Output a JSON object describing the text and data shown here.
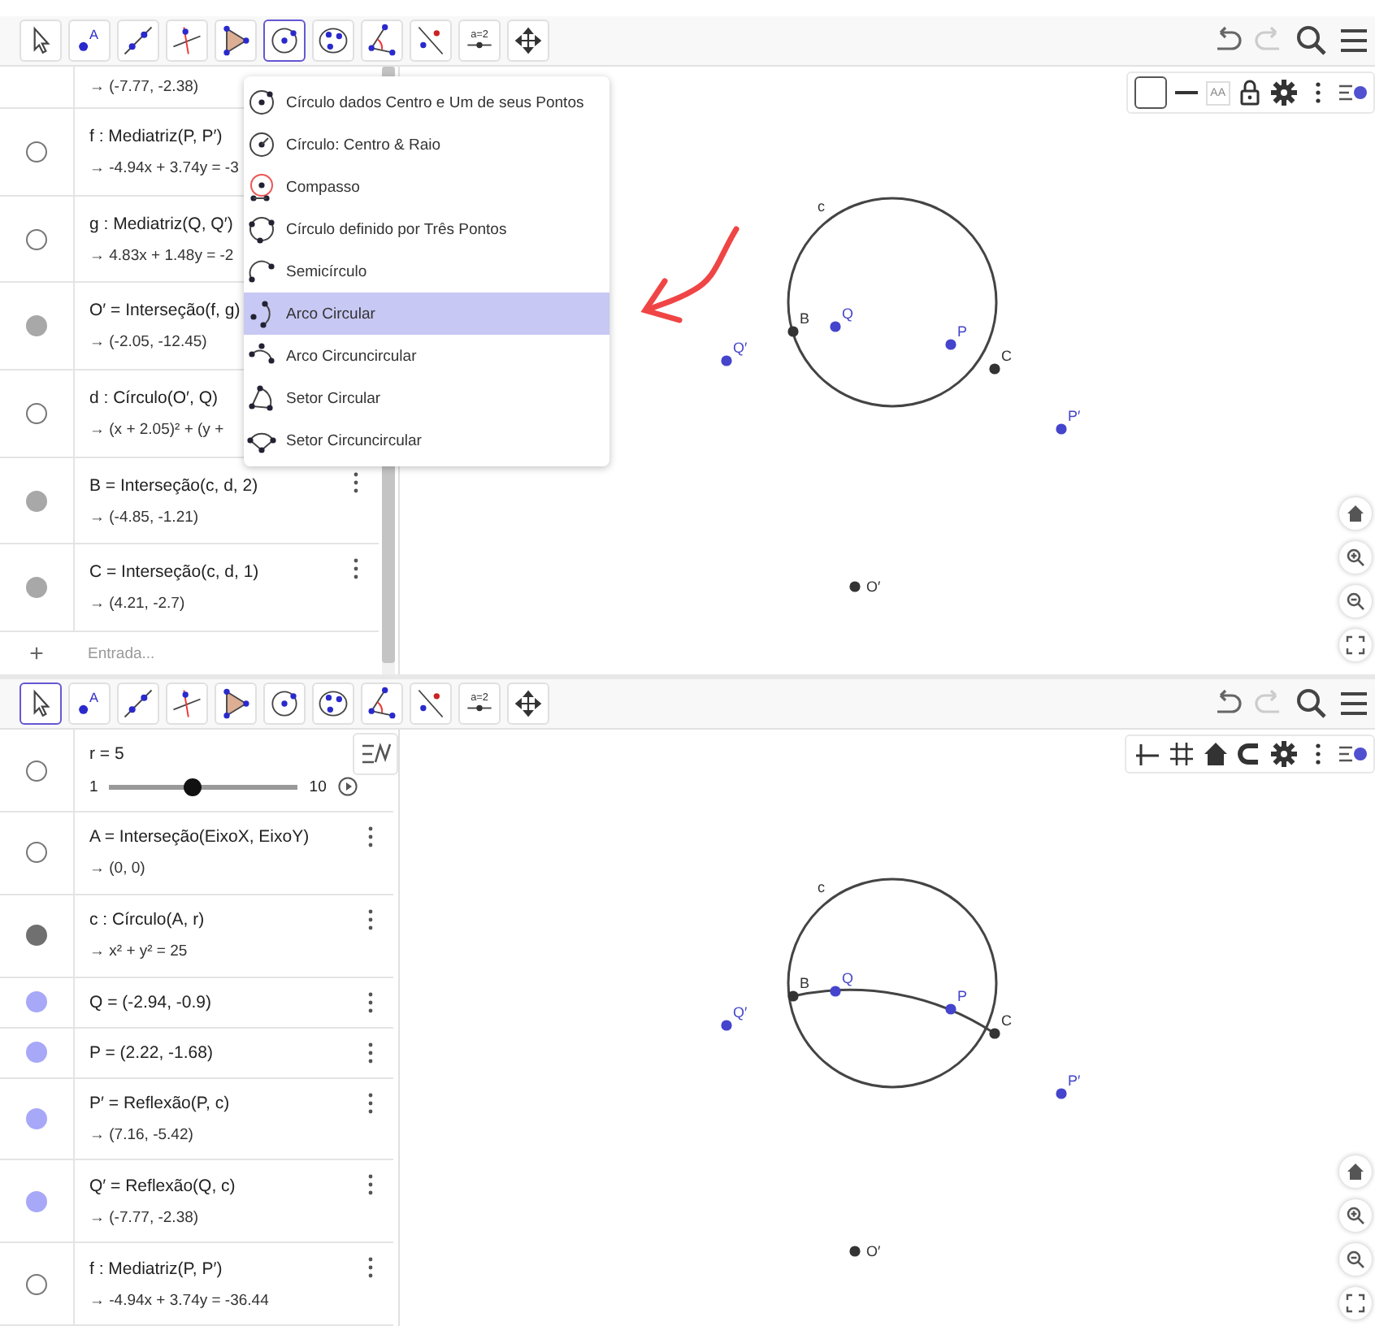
{
  "panes": [
    {
      "toolbar": {
        "tools": [
          {
            "kind": "move",
            "selected": false
          },
          {
            "kind": "point",
            "label": "A",
            "selected": false
          },
          {
            "kind": "line",
            "selected": false
          },
          {
            "kind": "perpendicular",
            "selected": false
          },
          {
            "kind": "polygon",
            "selected": false
          },
          {
            "kind": "circle",
            "selected": true
          },
          {
            "kind": "conic",
            "selected": false
          },
          {
            "kind": "angle",
            "selected": false
          },
          {
            "kind": "reflect",
            "selected": false
          },
          {
            "kind": "slider",
            "label": "a=2",
            "selected": false
          },
          {
            "kind": "pan",
            "selected": false
          }
        ],
        "undo_disabled": false,
        "redo_disabled": true
      },
      "dropdown": [
        {
          "kind": "circle-center-point",
          "label": "Círculo dados Centro e Um de seus Pontos",
          "selected": false
        },
        {
          "kind": "circle-center-radius",
          "label": "Círculo: Centro & Raio",
          "selected": false
        },
        {
          "kind": "compass",
          "label": "Compasso",
          "selected": false
        },
        {
          "kind": "circle-three-points",
          "label": "Círculo definido por Três Pontos",
          "selected": false
        },
        {
          "kind": "semicircle",
          "label": "Semicírculo",
          "selected": false
        },
        {
          "kind": "arc",
          "label": "Arco Circular",
          "selected": true
        },
        {
          "kind": "circumcircular-arc",
          "label": "Arco Circuncircular",
          "selected": false
        },
        {
          "kind": "sector",
          "label": "Setor Circular",
          "selected": false
        },
        {
          "kind": "circumcircular-sector",
          "label": "Setor Circuncircular",
          "selected": false
        }
      ],
      "algebra": {
        "rows": [
          {
            "kind": "partial",
            "value": "→ (-7.77, -2.38)"
          },
          {
            "kind": "two-line",
            "definition": "f : Mediatriz(P, P′)",
            "value": "→ -4.94x + 3.74y = -3",
            "visible": false,
            "menu_button": false
          },
          {
            "kind": "two-line",
            "definition": "g : Mediatriz(Q, Q′)",
            "value": "→ 4.83x + 1.48y = -2",
            "visible": false,
            "menu_button": false
          },
          {
            "kind": "two-line",
            "definition": "O′ = Interseção(f, g)",
            "value": "→ (-2.05, -12.45)",
            "visible": true,
            "color": "#a8a8a8",
            "menu_button": false
          },
          {
            "kind": "two-line",
            "definition": "d : Círculo(O′, Q)",
            "value": "→ (x + 2.05)² + (y +",
            "visible": false,
            "menu_button": false
          },
          {
            "kind": "two-line",
            "definition": "B = Interseção(c, d, 2)",
            "value": "→ (-4.85, -1.21)",
            "visible": true,
            "color": "#a8a8a8",
            "menu_button": true
          },
          {
            "kind": "two-line",
            "definition": "C = Interseção(c, d, 1)",
            "value": "→ (4.21, -2.7)",
            "visible": true,
            "color": "#a8a8a8",
            "menu_button": true
          }
        ],
        "input_add": "+",
        "input_placeholder": "Entrada...",
        "algebra_toggle": false
      },
      "style_bar": [
        {
          "kind": "color"
        },
        {
          "kind": "line-style"
        },
        {
          "kind": "text-size",
          "label": "AA"
        },
        {
          "kind": "lock"
        },
        {
          "kind": "settings"
        },
        {
          "kind": "more"
        },
        {
          "kind": "toggle"
        }
      ],
      "graphics": {
        "circle_label": "c",
        "arc": false,
        "points": [
          {
            "label": "B",
            "color": "#333333"
          },
          {
            "label": "Q",
            "color": "#4444cc"
          },
          {
            "label": "P",
            "color": "#4444cc"
          },
          {
            "label": "C",
            "color": "#333333"
          },
          {
            "label": "Q′",
            "color": "#4444cc"
          },
          {
            "label": "P′",
            "color": "#4444cc"
          },
          {
            "label": "O′",
            "color": "#333333"
          }
        ]
      }
    },
    {
      "toolbar": {
        "tools": [
          {
            "kind": "move",
            "selected": true
          },
          {
            "kind": "point",
            "label": "A",
            "selected": false
          },
          {
            "kind": "line",
            "selected": false
          },
          {
            "kind": "perpendicular",
            "selected": false
          },
          {
            "kind": "polygon",
            "selected": false
          },
          {
            "kind": "circle",
            "selected": false
          },
          {
            "kind": "conic",
            "selected": false
          },
          {
            "kind": "angle",
            "selected": false
          },
          {
            "kind": "reflect",
            "selected": false
          },
          {
            "kind": "slider",
            "label": "a=2",
            "selected": false
          },
          {
            "kind": "pan",
            "selected": false
          }
        ],
        "undo_disabled": false,
        "redo_disabled": true
      },
      "algebra": {
        "rows": [
          {
            "kind": "slider",
            "definition": "r = 5",
            "min": "1",
            "max": "10",
            "level": 0.444,
            "visible": false
          },
          {
            "kind": "two-line",
            "definition": "A = Interseção(EixoX, EixoY)",
            "value": "→ (0, 0)",
            "visible": false,
            "menu_button": true
          },
          {
            "kind": "two-line",
            "definition": "c : Círculo(A, r)",
            "value": "→ x² + y² = 25",
            "visible": true,
            "color": "#707070",
            "menu_button": true
          },
          {
            "kind": "one-line",
            "definition": "Q = (-2.94, -0.9)",
            "visible": true,
            "color": "#a8a8f8",
            "menu_button": true
          },
          {
            "kind": "one-line",
            "definition": "P = (2.22, -1.68)",
            "visible": true,
            "color": "#a8a8f8",
            "menu_button": true
          },
          {
            "kind": "two-line",
            "definition": "P′ = Reflexão(P, c)",
            "value": "→ (7.16, -5.42)",
            "visible": true,
            "color": "#a8a8f8",
            "menu_button": true
          },
          {
            "kind": "two-line",
            "definition": "Q′ = Reflexão(Q, c)",
            "value": "→ (-7.77, -2.38)",
            "visible": true,
            "color": "#a8a8f8",
            "menu_button": true
          },
          {
            "kind": "two-line",
            "definition": "f : Mediatriz(P, P′)",
            "value": "→ -4.94x + 3.74y = -36.44",
            "visible": false,
            "menu_button": true
          }
        ],
        "algebra_toggle": true
      },
      "style_bar": [
        {
          "kind": "axes"
        },
        {
          "kind": "grid"
        },
        {
          "kind": "home"
        },
        {
          "kind": "capture"
        },
        {
          "kind": "settings"
        },
        {
          "kind": "more"
        },
        {
          "kind": "toggle"
        }
      ],
      "graphics": {
        "circle_label": "c",
        "arc": true,
        "points": [
          {
            "label": "B",
            "color": "#333333"
          },
          {
            "label": "Q",
            "color": "#4444cc"
          },
          {
            "label": "P",
            "color": "#4444cc"
          },
          {
            "label": "C",
            "color": "#333333"
          },
          {
            "label": "Q′",
            "color": "#4444cc"
          },
          {
            "label": "P′",
            "color": "#4444cc"
          },
          {
            "label": "O′",
            "color": "#333333"
          }
        ]
      }
    }
  ]
}
